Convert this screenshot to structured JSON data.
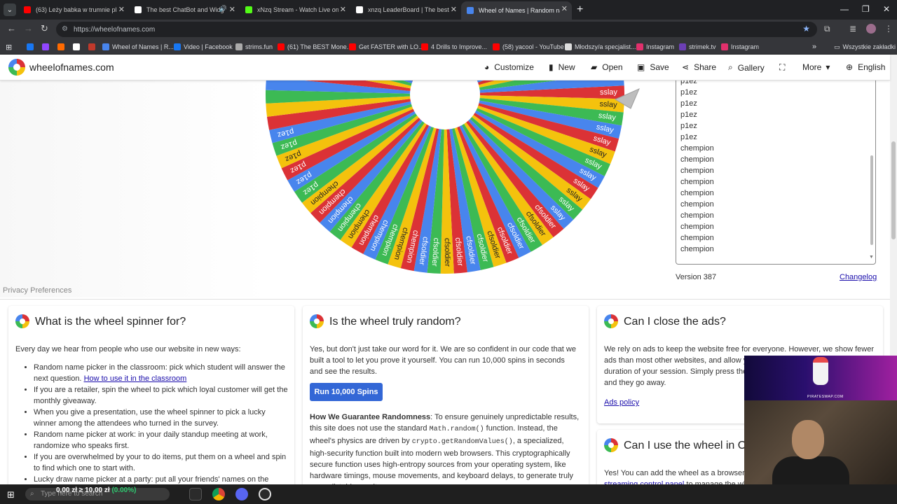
{
  "browser": {
    "tabs": [
      {
        "title": "(63) Leży babka w trumnie placi",
        "icon": "youtube-icon",
        "color": "#ff0000"
      },
      {
        "title": "The best ChatBot and Widg",
        "icon": "chatbot-icon",
        "color": "#ffffff",
        "audio": true
      },
      {
        "title": "xNzq Stream - Watch Live on K",
        "icon": "kick-icon",
        "color": "#53fc18"
      },
      {
        "title": "xnzq LeaderBoard | The best Ch",
        "icon": "chatbot-icon",
        "color": "#ffffff"
      },
      {
        "title": "Wheel of Names | Random nam",
        "icon": "wheel-icon",
        "color": "#4885ed",
        "active": true
      }
    ],
    "url": "https://wheelofnames.com",
    "bookmarks": [
      {
        "label": "",
        "icon": "facebook-icon",
        "color": "#1877f2"
      },
      {
        "label": "",
        "icon": "twitch-icon",
        "color": "#9146ff"
      },
      {
        "label": "",
        "icon": "bookmark-icon",
        "color": "#ff6a00"
      },
      {
        "label": "",
        "icon": "x-icon",
        "color": "#ffffff"
      },
      {
        "label": "",
        "icon": "bookmark-icon",
        "color": "#c0392b"
      },
      {
        "label": "Wheel of Names | R...",
        "icon": "wheel-icon",
        "color": "#4885ed"
      },
      {
        "label": "Video | Facebook",
        "icon": "facebook-icon",
        "color": "#1877f2"
      },
      {
        "label": "strims.fun",
        "icon": "bookmark-icon",
        "color": "#aaaaaa"
      },
      {
        "label": "(61) The BEST Mone...",
        "icon": "youtube-icon",
        "color": "#ff0000"
      },
      {
        "label": "Get FASTER with LO...",
        "icon": "youtube-icon",
        "color": "#ff0000"
      },
      {
        "label": "4 Drills to Improve...",
        "icon": "youtube-icon",
        "color": "#ff0000"
      },
      {
        "label": "(58) yacool - YouTube",
        "icon": "youtube-icon",
        "color": "#ff0000"
      },
      {
        "label": "Młodszy/a specjalist...",
        "icon": "bookmark-icon",
        "color": "#dddddd"
      },
      {
        "label": "Instagram",
        "icon": "instagram-icon",
        "color": "#e1306c"
      },
      {
        "label": "strimek.tv",
        "icon": "bookmark-icon",
        "color": "#6c3fb5"
      },
      {
        "label": "Instagram",
        "icon": "instagram-icon",
        "color": "#e1306c"
      }
    ],
    "all_bookmarks": "Wszystkie zakładki"
  },
  "site": {
    "name": "wheelofnames.com",
    "menu": [
      {
        "label": "Customize",
        "icon": "palette-icon"
      },
      {
        "label": "New",
        "icon": "file-icon"
      },
      {
        "label": "Open",
        "icon": "folder-icon"
      },
      {
        "label": "Save",
        "icon": "save-icon"
      },
      {
        "label": "Share",
        "icon": "share-icon"
      },
      {
        "label": "Gallery",
        "icon": "search-icon"
      },
      {
        "label": "",
        "icon": "fullscreen-icon"
      },
      {
        "label": "More",
        "icon": "chevron-down-icon"
      },
      {
        "label": "English",
        "icon": "globe-icon"
      }
    ],
    "privacy": "Privacy Preferences",
    "version": "Version 387",
    "changelog": "Changelog"
  },
  "wheel": {
    "colors": [
      "#db3236",
      "#f4c20d",
      "#3cba54",
      "#4885ed"
    ],
    "entries_visible": [
      "sslay",
      "sslay",
      "sslay",
      "sslay",
      "sslay",
      "sslay",
      "sslay",
      "sslay",
      "sslay",
      "sslay",
      "sslay",
      "sslay",
      "cfsoldier",
      "cfsoldier",
      "cfsoldier",
      "cfsoldier",
      "cfsoldier",
      "cfsoldier",
      "cfsoldier",
      "cfsoldier",
      "cfsoldier",
      "cfsoldier",
      "cfsoldier",
      "cfsoldier",
      "chempion",
      "chempion",
      "chempion",
      "chempion",
      "chempion",
      "chempion",
      "chempion",
      "chempion",
      "chempion",
      "chempion",
      "p1ez",
      "p1ez",
      "p1ez",
      "p1ez",
      "p1ez",
      "p1ez"
    ]
  },
  "entries": [
    "p1ez",
    "p1ez",
    "p1ez",
    "p1ez",
    "p1ez",
    "p1ez",
    "chempion",
    "chempion",
    "chempion",
    "chempion",
    "chempion",
    "chempion",
    "chempion",
    "chempion",
    "chempion",
    "chempion"
  ],
  "cards": {
    "wheel_spinner": {
      "title": "What is the wheel spinner for?",
      "intro": "Every day we hear from people who use our website in new ways:",
      "items": [
        {
          "text": "Random name picker in the classroom: pick which student will answer the next question. ",
          "link": "How to use it in the classroom"
        },
        {
          "text": "If you are a retailer, spin the wheel to pick which loyal customer will get the monthly giveaway."
        },
        {
          "text": "When you give a presentation, use the wheel spinner to pick a lucky winner among the attendees who turned in the survey."
        },
        {
          "text": "Random name picker at work: in your daily standup meeting at work, randomize who speaks first."
        },
        {
          "text": "If you are overwhelmed by your to do items, put them on a wheel and spin to find which one to start with."
        },
        {
          "text": "Lucky draw name picker at a party: put all your friends' names on the wheel"
        }
      ]
    },
    "random": {
      "title": "Is the wheel truly random?",
      "p1": "Yes, but don't just take our word for it. We are so confident in our code that we built a tool to let you prove it yourself. You can run 10,000 spins in seconds and see the results.",
      "button": "Run 10,000 Spins",
      "p2_bold": "How We Guarantee Randomness",
      "p2_a": ": To ensure genuinely unpredictable results, this site does not use the standard ",
      "p2_code1": "Math.random()",
      "p2_b": " function. Instead, the wheel's physics are driven by ",
      "p2_code2": "crypto.getRandomValues()",
      "p2_c": ", a specialized, high-security function built into modern web browsers. This cryptographically secure function uses high-entropy sources from your operating system, like hardware timings, mouse movements, and keyboard delays, to generate truly unpredictable results."
    },
    "ads": {
      "title": "Can I close the ads?",
      "text": "We rely on ads to keep the website free for everyone. However, we show fewer ads than most other websites, and allow y",
      "text2": "duration of your session. Simply press the",
      "text3": "and they go away.",
      "link": "Ads policy"
    },
    "obs": {
      "title": "Can I use the wheel in OB",
      "text": "Yes! You can add the wheel as a browser s",
      "link": "streaming control panel",
      "text2": " to manage the wh"
    }
  },
  "overlay": {
    "ad_label": "PIRATESWAP.COM",
    "ticker_value": "0,00 zł ≥ 10,00 zł",
    "ticker_pct": "(0.00%)",
    "search_placeholder": "Type here to search"
  }
}
